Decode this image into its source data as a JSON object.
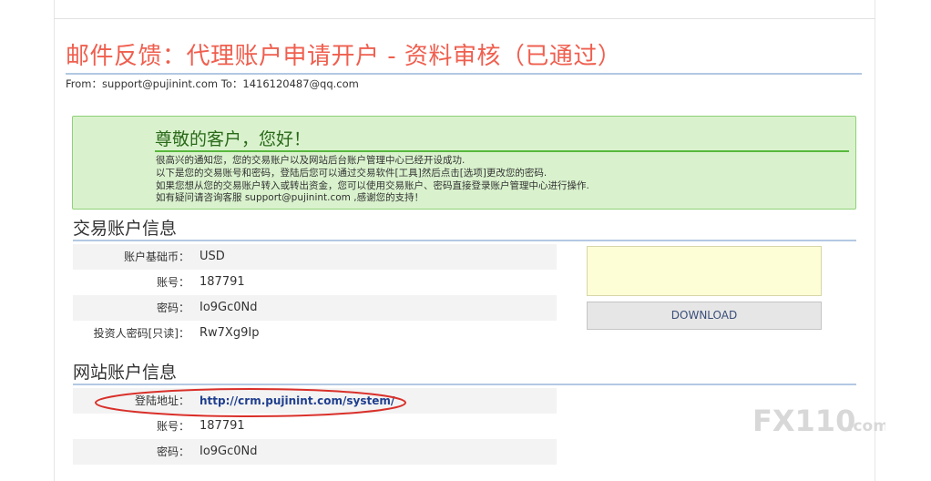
{
  "email": {
    "title": "邮件反馈：代理账户申请开户 - 资料审核（已通过）",
    "from_line": "From：support@pujinint.com To：1416120487@qq.com"
  },
  "notice": {
    "greeting": "尊敬的客户，您好！",
    "lines": [
      "很高兴的通知您，您的交易账户以及网站后台账户管理中心已经开设成功.",
      "以下是您的交易账号和密码，登陆后您可以通过交易软件[工具]然后点击[选项]更改您的密码.",
      "如果您想从您的交易账户转入或转出资金，您可以使用交易账户、密码直接登录账户管理中心进行操作.",
      "如有疑问请咨询客服 support@pujinint.com ,感谢您的支持！"
    ]
  },
  "trading": {
    "title": "交易账户信息",
    "rows": [
      {
        "label": "账户基础币：",
        "value": "USD"
      },
      {
        "label": "账号：",
        "value": "187791"
      },
      {
        "label": "密码：",
        "value": "Io9Gc0Nd"
      },
      {
        "label": "投资人密码[只读]：",
        "value": "Rw7Xg9Ip"
      }
    ],
    "download_label": "DOWNLOAD"
  },
  "website": {
    "title": "网站账户信息",
    "rows": [
      {
        "label": "登陆地址：",
        "value": "http://crm.pujinint.com/system/"
      },
      {
        "label": "账号：",
        "value": "187791"
      },
      {
        "label": "密码：",
        "value": "Io9Gc0Nd"
      }
    ]
  },
  "watermark": {
    "brand": "FX110",
    "suffix": ".com"
  },
  "colors": {
    "title": "#ef5f4f",
    "notice_bg": "#d9f2cd",
    "notice_border": "#8fd178",
    "section_rule": "#b3c8e3",
    "highlight_ellipse": "#d9302a"
  }
}
